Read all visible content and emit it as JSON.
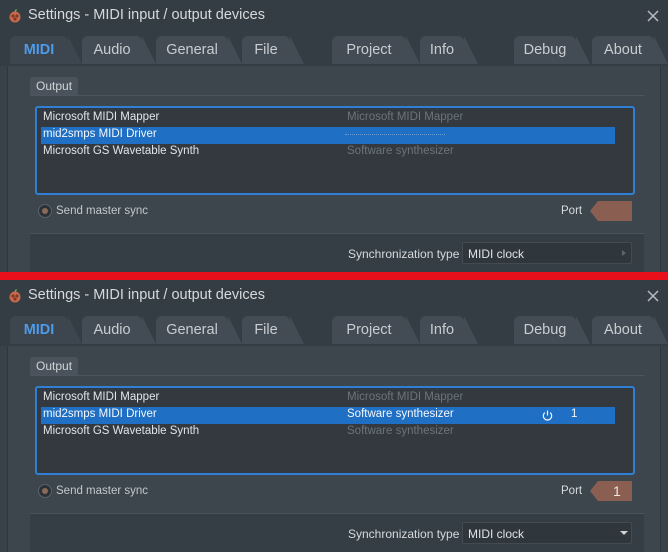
{
  "window": {
    "title": "Settings - MIDI input / output devices"
  },
  "tabs": [
    {
      "label": "MIDI",
      "active": true
    },
    {
      "label": "Audio"
    },
    {
      "label": "General"
    },
    {
      "label": "File"
    },
    {
      "label": "Project"
    },
    {
      "label": "Info"
    },
    {
      "label": "Debug"
    },
    {
      "label": "About"
    }
  ],
  "output": {
    "section_label": "Output",
    "devices": [
      {
        "name": "Microsoft MIDI Mapper",
        "description": "Microsoft MIDI Mapper"
      },
      {
        "name": "mid2smps MIDI Driver",
        "description": "Software synthesizer",
        "selected": true,
        "port": "1"
      },
      {
        "name": "Microsoft GS Wavetable Synth",
        "description": "Software synthesizer"
      }
    ]
  },
  "send_master_sync_label": "Send master sync",
  "port": {
    "label": "Port",
    "value": "1"
  },
  "synchronization": {
    "label": "Synchronization type",
    "value": "MIDI clock"
  },
  "colors": {
    "accent": "#2f7fd6",
    "selected_row": "#1f6fc4",
    "divider": "#e8101a",
    "port_box": "#8a5e50"
  },
  "icons": {
    "app": "fl-studio-fruit-icon",
    "close": "close-icon",
    "power": "power-icon",
    "dropdown": "chevron-down-icon"
  }
}
